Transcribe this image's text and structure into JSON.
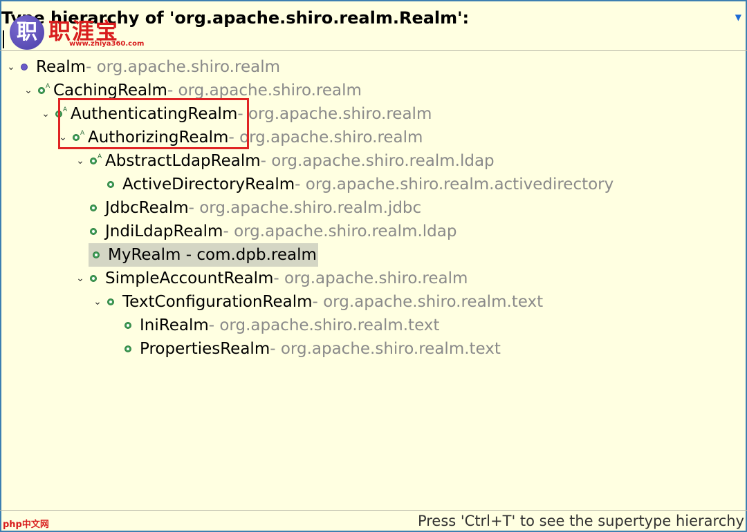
{
  "header": {
    "title": "Type hierarchy of 'org.apache.shiro.realm.Realm':",
    "menu_glyph": "▼"
  },
  "watermark": {
    "logo_char": "职",
    "logo_text": "职涯宝",
    "logo_url": "www.zhiya360.com",
    "footer_logo": "php中文网"
  },
  "tree": [
    {
      "name": "Realm",
      "pkg": " - org.apache.shiro.realm",
      "icon": "interface-icon",
      "expanded": true
    },
    {
      "name": "CachingRealm",
      "pkg": " - org.apache.shiro.realm",
      "icon": "abstract-class-icon",
      "expanded": true
    },
    {
      "name": "AuthenticatingRealm",
      "pkg": " - org.apache.shiro.realm",
      "icon": "abstract-class-icon",
      "expanded": true
    },
    {
      "name": "AuthorizingRealm",
      "pkg": " - org.apache.shiro.realm",
      "icon": "abstract-class-icon",
      "expanded": true
    },
    {
      "name": "AbstractLdapRealm",
      "pkg": " - org.apache.shiro.realm.ldap",
      "icon": "abstract-class-icon",
      "expanded": true
    },
    {
      "name": "ActiveDirectoryRealm",
      "pkg": " - org.apache.shiro.realm.activedirectory",
      "icon": "class-icon",
      "expanded": false
    },
    {
      "name": "JdbcRealm",
      "pkg": " - org.apache.shiro.realm.jdbc",
      "icon": "class-icon",
      "expanded": false
    },
    {
      "name": "JndiLdapRealm",
      "pkg": " - org.apache.shiro.realm.ldap",
      "icon": "class-icon",
      "expanded": false
    },
    {
      "name": "MyRealm - com.dpb.realm",
      "pkg": "",
      "icon": "class-icon",
      "expanded": false,
      "selected": true
    },
    {
      "name": "SimpleAccountRealm",
      "pkg": " - org.apache.shiro.realm",
      "icon": "class-icon",
      "expanded": true
    },
    {
      "name": "TextConfigurationRealm",
      "pkg": " - org.apache.shiro.realm.text",
      "icon": "class-icon",
      "expanded": true
    },
    {
      "name": "IniRealm",
      "pkg": " - org.apache.shiro.realm.text",
      "icon": "class-icon",
      "expanded": false
    },
    {
      "name": "PropertiesRealm",
      "pkg": " - org.apache.shiro.realm.text",
      "icon": "class-icon",
      "expanded": false
    }
  ],
  "status": {
    "hint": "Press 'Ctrl+T' to see the supertype hierarchy"
  },
  "colors": {
    "background": "#ffffe1",
    "package_text": "#8a8a8a",
    "highlight_box": "#e02424",
    "class_icon": "#3e9d55",
    "interface_icon": "#6a5ac8"
  }
}
